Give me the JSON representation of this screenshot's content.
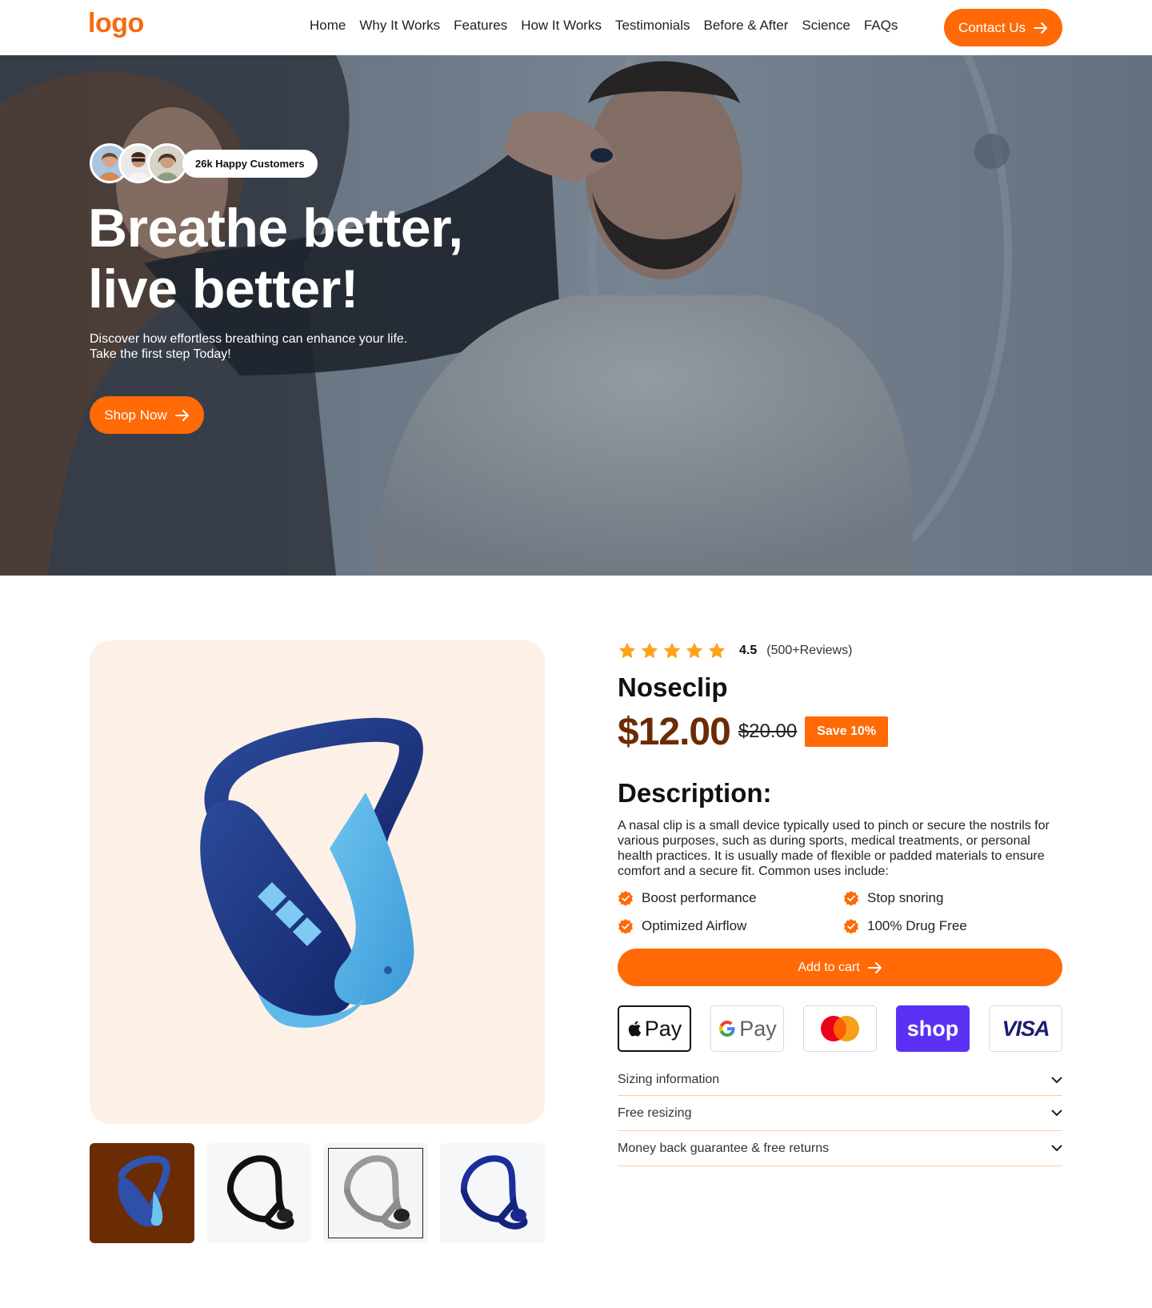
{
  "header": {
    "logo": "logo",
    "nav": [
      "Home",
      "Why It Works",
      "Features",
      "How It Works",
      "Testimonials",
      "Before & After",
      "Science",
      "FAQs"
    ],
    "contact_label": "Contact Us"
  },
  "hero": {
    "badge": "26k Happy Customers",
    "title_line1": "Breathe better,",
    "title_line2": "live better!",
    "subtitle_line1": "Discover how effortless breathing can enhance your life.",
    "subtitle_line2": "Take the first step Today!",
    "cta": "Shop Now"
  },
  "product": {
    "rating": "4.5",
    "review_count": "(500+Reviews)",
    "stars": 5,
    "name": "Noseclip",
    "price": "$12.00",
    "old_price": "$20.00",
    "save": "Save 10%",
    "description_title": "Description:",
    "description": "A nasal clip is a small device typically used to pinch or secure the nostrils for various purposes, such as during sports, medical treatments, or personal health practices. It is usually made of flexible or padded materials to ensure comfort and a secure fit. Common uses include:",
    "features": [
      "Boost performance",
      "Stop snoring",
      "Optimized Airflow",
      "100% Drug Free"
    ],
    "cart": "Add to cart",
    "payments": [
      "Pay",
      "Pay",
      "shop",
      "VISA"
    ],
    "accordion": [
      "Sizing information",
      "Free resizing",
      "Money back guarantee & free returns"
    ]
  },
  "colors": {
    "accent": "#ff6a06",
    "price": "#6b2c04",
    "image_bg": "#fdf0e7",
    "shop_pay": "#5a31f4"
  }
}
